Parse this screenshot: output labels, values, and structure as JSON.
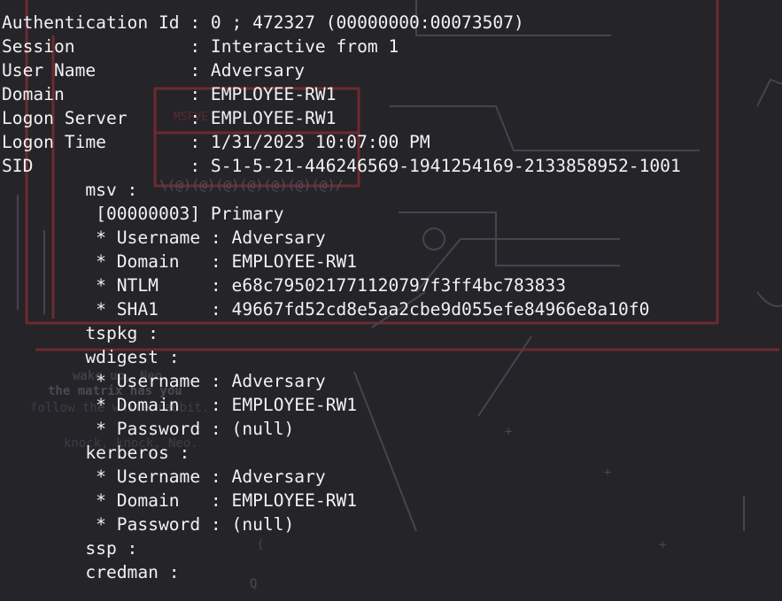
{
  "terminal": {
    "lines": [
      "Authentication Id : 0 ; 472327 (00000000:00073507)",
      "Session           : Interactive from 1",
      "User Name         : Adversary",
      "Domain            : EMPLOYEE-RW1",
      "Logon Server      : EMPLOYEE-RW1",
      "Logon Time        : 1/31/2023 10:07:00 PM",
      "SID               : S-1-5-21-446246569-1941254169-2133858952-1001",
      "        msv :",
      "         [00000003] Primary",
      "         * Username : Adversary",
      "         * Domain   : EMPLOYEE-RW1",
      "         * NTLM     : e68c795021771120797f3ff4bc783833",
      "         * SHA1     : 49667fd52cd8e5aa2cbe9d055efe84966e8a10f0",
      "        tspkg :",
      "        wdigest :",
      "         * Username : Adversary",
      "         * Domain   : EMPLOYEE-RW1",
      "         * Password : (null)",
      "        kerberos :",
      "         * Username : Adversary",
      "         * Domain   : EMPLOYEE-RW1",
      "         * Password : (null)",
      "        ssp :",
      "        credman :"
    ]
  },
  "wallpaper": {
    "label": "MSFVE",
    "at_row": "\\(@)(@)(@)(@)(@)(@)(@)/",
    "matrix_lines": [
      "wake up, Neo...",
      "the matrix has you",
      "follow the white rabbit.",
      "knock, knock, Neo."
    ]
  },
  "colors": {
    "background": "#242429",
    "text": "#f2f2f2",
    "wallpaper_red": "#7a2a30",
    "wallpaper_gray": "#4a4a52"
  }
}
